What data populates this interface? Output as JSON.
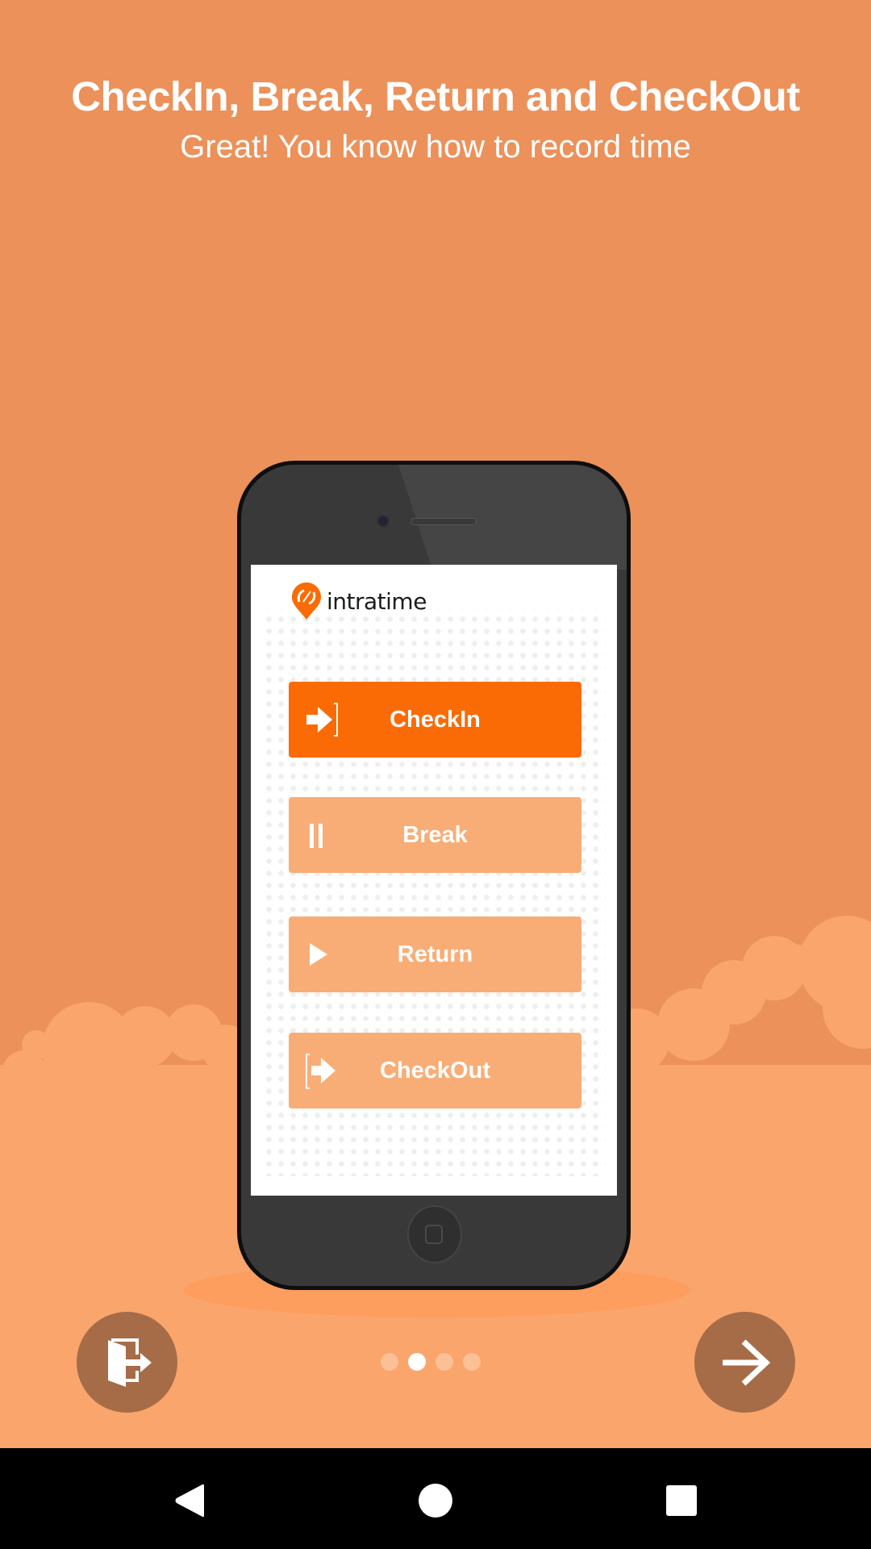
{
  "onboarding": {
    "title": "CheckIn, Break, Return and CheckOut",
    "subtitle": "Great! You know how to record time",
    "page_indicator": {
      "total": 4,
      "current": 2
    }
  },
  "phone_mockup": {
    "app_name": "intratime",
    "buttons": [
      {
        "label": "CheckIn",
        "icon": "checkin-arrow-icon",
        "state": "active"
      },
      {
        "label": "Break",
        "icon": "pause-icon",
        "state": "inactive"
      },
      {
        "label": "Return",
        "icon": "play-icon",
        "state": "inactive"
      },
      {
        "label": "CheckOut",
        "icon": "checkout-arrow-icon",
        "state": "inactive"
      }
    ]
  },
  "actions": {
    "exit_icon": "exit-door-icon",
    "next_icon": "arrow-right-icon"
  },
  "system_nav": {
    "back": "back-icon",
    "home": "home-icon",
    "recents": "recents-icon"
  },
  "colors": {
    "background": "#ec915a",
    "cloud": "#f9a56c",
    "accent": "#fb6b05",
    "button_inactive": "#f9ad76",
    "circle_button": "#a66c47"
  }
}
